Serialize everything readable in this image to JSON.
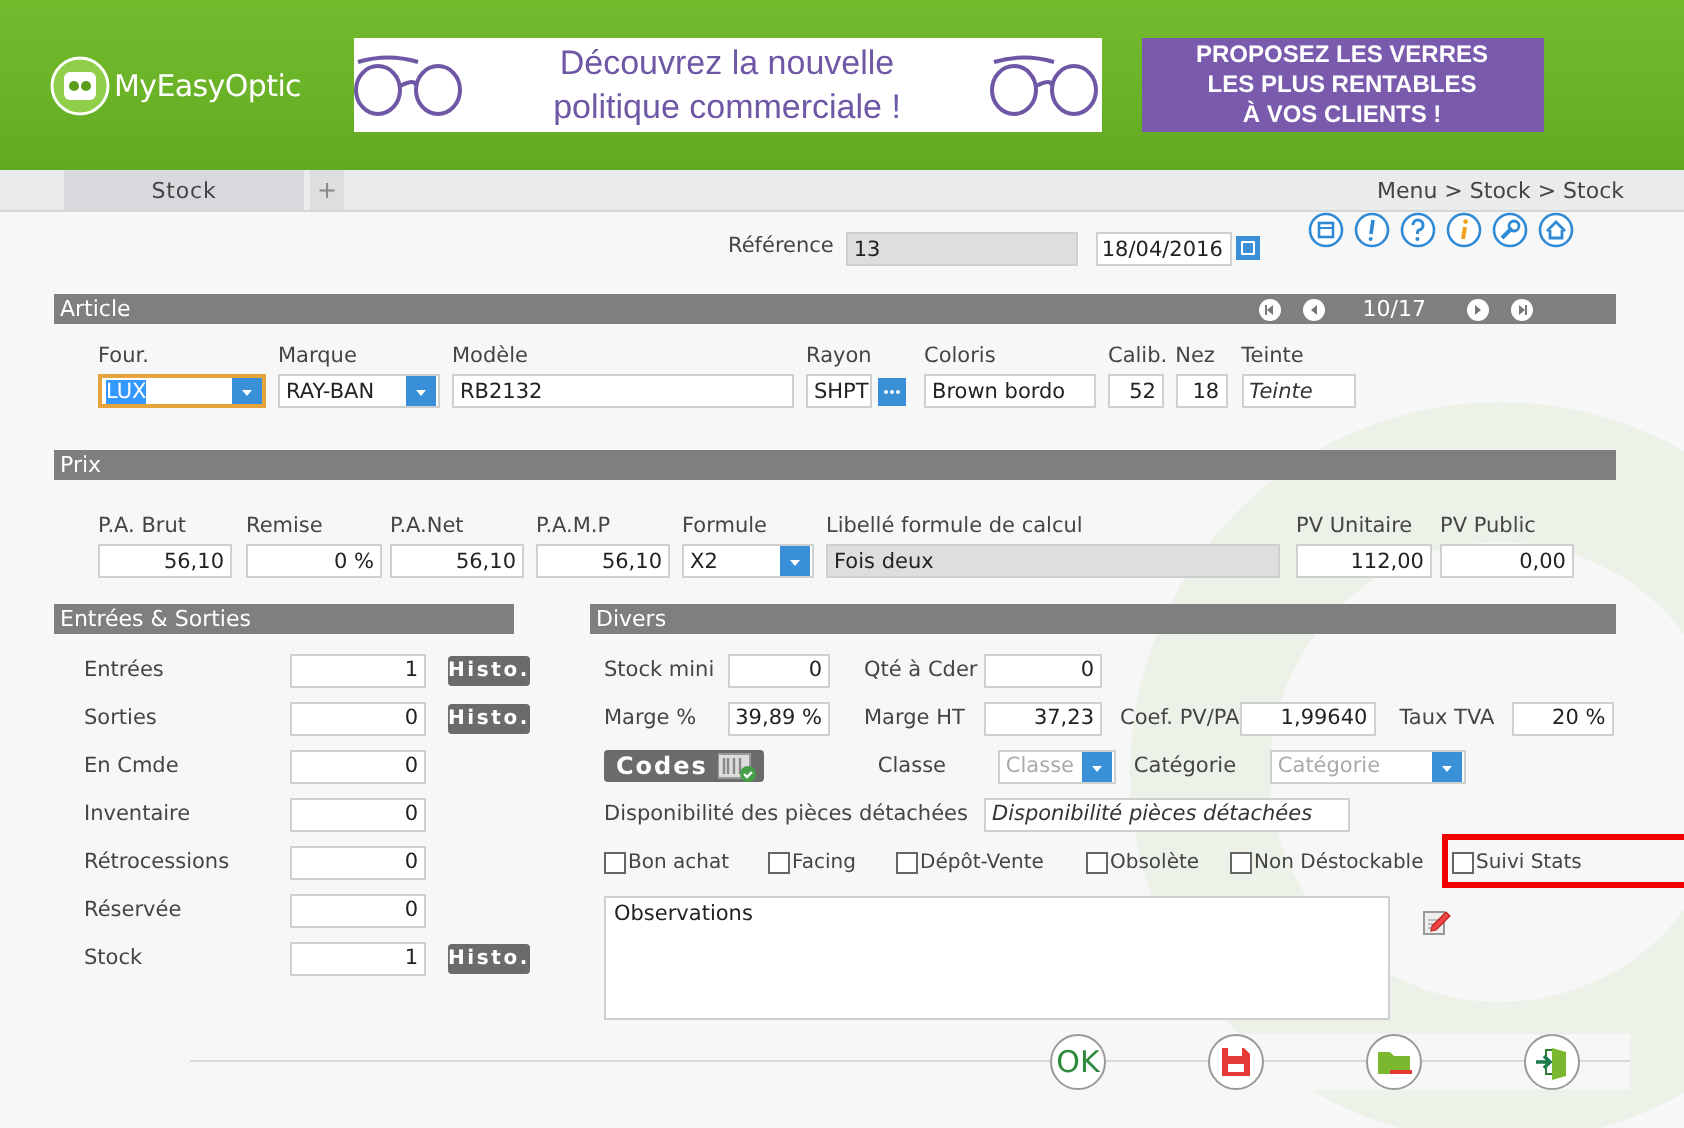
{
  "header": {
    "logo": "MyEasyOptic",
    "banner_lines": [
      "Découvrez la nouvelle",
      "politique commerciale !"
    ],
    "promo_lines": [
      "PROPOSEZ LES VERRES",
      "LES PLUS RENTABLES",
      "À VOS CLIENTS !"
    ]
  },
  "tabs": [
    {
      "label": "Stock",
      "selected": true
    }
  ],
  "add_tab": "+",
  "breadcrumb": "Menu > Stock > Stock",
  "reference": {
    "label": "Référence",
    "value": "13",
    "date": "18/04/2016"
  },
  "article": {
    "title": "Article",
    "pager": "10/17",
    "fields": [
      {
        "label": "Four.",
        "kind": "select",
        "value": "LUX",
        "focused": true
      },
      {
        "label": "Marque",
        "kind": "select",
        "value": "RAY-BAN",
        "focused": false
      },
      {
        "label": "Modèle",
        "kind": "text",
        "value": "RB2132",
        "focused": false
      },
      {
        "label": "Rayon",
        "kind": "lookup",
        "value": "SHPT",
        "focused": false
      },
      {
        "label": "Coloris",
        "kind": "text",
        "value": "Brown bordo",
        "focused": false
      },
      {
        "label": "Calib.",
        "kind": "number",
        "value": "52",
        "focused": false
      },
      {
        "label": "Nez",
        "kind": "number",
        "value": "18",
        "focused": false
      },
      {
        "label": "Teinte",
        "kind": "text",
        "placeholder": "Teinte",
        "focused": false
      }
    ]
  },
  "prix": {
    "title": "Prix",
    "fields": [
      {
        "label": "P.A. Brut",
        "kind": "number",
        "value": "56,10"
      },
      {
        "label": "Remise",
        "kind": "number",
        "value": "0 %"
      },
      {
        "label": "P.A.Net",
        "kind": "number",
        "value": "56,10"
      },
      {
        "label": "P.A.M.P",
        "kind": "number",
        "value": "56,10"
      },
      {
        "label": "Formule",
        "kind": "select",
        "value": "X2"
      },
      {
        "label": "Libellé formule de calcul",
        "kind": "readonly",
        "value": "Fois deux"
      },
      {
        "label": "PV Unitaire",
        "kind": "number",
        "value": "112,00"
      },
      {
        "label": "PV Public",
        "kind": "number",
        "value": "0,00"
      }
    ]
  },
  "entrees_sorties": {
    "title": "Entrées & Sorties",
    "rows": [
      {
        "label": "Entrées",
        "value": "1",
        "button": "Histo."
      },
      {
        "label": "Sorties",
        "value": "0",
        "button": "Histo."
      },
      {
        "label": "En Cmde",
        "value": "0"
      },
      {
        "label": "Inventaire",
        "value": "0"
      },
      {
        "label": "Rétrocessions",
        "value": "0"
      },
      {
        "label": "Réservée",
        "value": "0"
      },
      {
        "label": "Stock",
        "value": "1",
        "button": "Histo."
      }
    ]
  },
  "divers": {
    "title": "Divers",
    "rows": [
      [
        {
          "label": "Stock mini",
          "kind": "number",
          "value": "0"
        },
        {
          "label": "Qté à Cder",
          "kind": "number",
          "value": "0"
        }
      ],
      [
        {
          "label": "Marge %",
          "kind": "number",
          "value": "39,89 %"
        },
        {
          "label": "Marge HT",
          "kind": "number",
          "value": "37,23"
        },
        {
          "label": "Coef. PV/PA",
          "kind": "number",
          "value": "1,99640"
        },
        {
          "label": "Taux TVA",
          "kind": "number",
          "value": "20 %"
        }
      ],
      [
        {
          "label": "Codes",
          "kind": "button"
        },
        {
          "label": "Classe",
          "kind": "select",
          "placeholder": "Classe"
        },
        {
          "label": "Catégorie",
          "kind": "select",
          "placeholder": "Catégorie"
        }
      ],
      [
        {
          "label": "Disponibilité des pièces détachées",
          "kind": "text",
          "placeholder": "Disponibilité pièces détachées"
        }
      ]
    ],
    "checkboxes": [
      {
        "label": "Bon achat",
        "checked": false,
        "highlighted": false
      },
      {
        "label": "Facing",
        "checked": false,
        "highlighted": false
      },
      {
        "label": "Dépôt-Vente",
        "checked": false,
        "highlighted": false
      },
      {
        "label": "Obsolète",
        "checked": false,
        "highlighted": false
      },
      {
        "label": "Non Déstockable",
        "checked": false,
        "highlighted": false
      },
      {
        "label": "Suivi Stats",
        "checked": false,
        "highlighted": true
      }
    ],
    "observations": "Observations"
  },
  "actions": [
    {
      "kind": "ok",
      "label": "OK"
    },
    {
      "kind": "save"
    },
    {
      "kind": "folder"
    },
    {
      "kind": "exit"
    }
  ]
}
